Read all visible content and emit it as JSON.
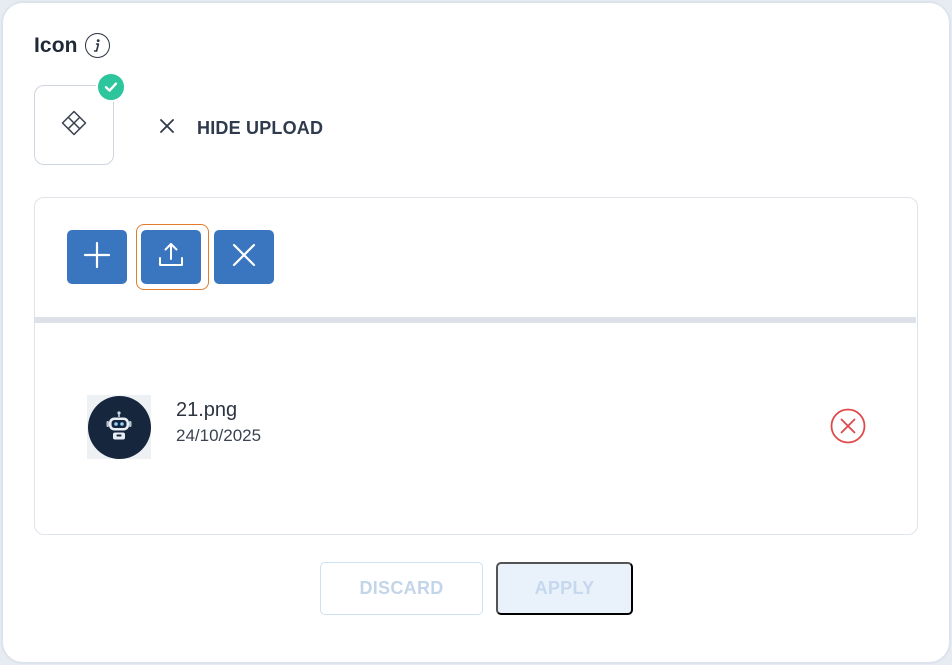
{
  "section": {
    "title": "Icon",
    "info_icon": "info-icon"
  },
  "preview": {
    "icon": "diamond-grid-icon",
    "status_icon": "check-icon",
    "status_color": "#2cc59c"
  },
  "hide_upload": {
    "label": "HIDE UPLOAD",
    "icon": "close-icon"
  },
  "toolbar": {
    "add_icon": "plus-icon",
    "upload_icon": "upload-icon",
    "clear_icon": "close-icon",
    "button_color": "#3a75bf",
    "focus_color": "#e47a2c"
  },
  "files": [
    {
      "name": "21.png",
      "date": "24/10/2025",
      "thumbnail": "robot-avatar",
      "remove_icon": "remove-circle-icon",
      "remove_color": "#e0484b"
    }
  ],
  "actions": {
    "discard_label": "DISCARD",
    "apply_label": "APPLY"
  }
}
